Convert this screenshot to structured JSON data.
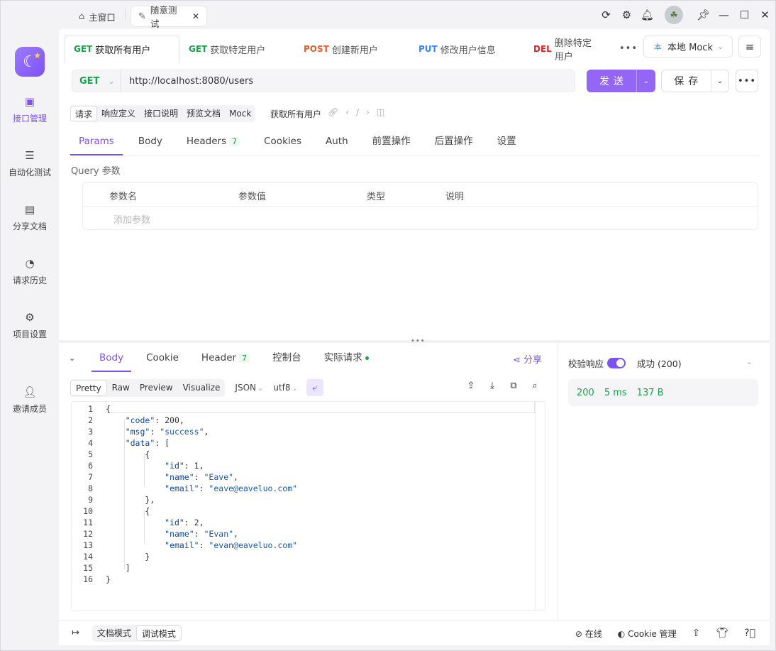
{
  "titlebar": {
    "home_tab": "主窗口",
    "active_tab": "随意测试"
  },
  "sidebar": {
    "items": [
      {
        "label": "接口管理",
        "icon": "api-management-icon"
      },
      {
        "label": "自动化测试",
        "icon": "automation-icon"
      },
      {
        "label": "分享文档",
        "icon": "share-doc-icon"
      },
      {
        "label": "请求历史",
        "icon": "history-icon"
      },
      {
        "label": "项目设置",
        "icon": "project-settings-icon"
      },
      {
        "label": "邀请成员",
        "icon": "invite-member-icon"
      }
    ]
  },
  "request_tabs": [
    {
      "method": "GET",
      "label": "获取所有用户"
    },
    {
      "method": "GET",
      "label": "获取特定用户"
    },
    {
      "method": "POST",
      "label": "创建新用户"
    },
    {
      "method": "PUT",
      "label": "修改用户信息"
    },
    {
      "method": "DEL",
      "label": "删除特定用户"
    }
  ],
  "environment": {
    "badge": "本",
    "label": "本地 Mock"
  },
  "url_bar": {
    "method": "GET",
    "url": "http://localhost:8080/users"
  },
  "actions": {
    "send": "发送",
    "save": "保存"
  },
  "view_modes": [
    "请求",
    "响应定义",
    "接口说明",
    "预览文档",
    "Mock"
  ],
  "view_title": "获取所有用户",
  "sub_tabs": {
    "params": "Params",
    "body": "Body",
    "headers": "Headers",
    "headers_count": "7",
    "cookies": "Cookies",
    "auth": "Auth",
    "pre": "前置操作",
    "post": "后置操作",
    "settings": "设置"
  },
  "query": {
    "label": "Query 参数",
    "columns": [
      "参数名",
      "参数值",
      "类型",
      "说明"
    ],
    "add_placeholder": "添加参数"
  },
  "response_tabs": {
    "body": "Body",
    "cookie": "Cookie",
    "header": "Header",
    "header_count": "7",
    "console": "控制台",
    "actual": "实际请求",
    "share": "分享"
  },
  "format": {
    "modes": [
      "Pretty",
      "Raw",
      "Preview",
      "Visualize"
    ],
    "type": "JSON",
    "encoding": "utf8"
  },
  "code_lines": [
    "{",
    "    \"code\": 200,",
    "    \"msg\": \"success\",",
    "    \"data\": [",
    "        {",
    "            \"id\": 1,",
    "            \"name\": \"Eave\",",
    "            \"email\": \"eave@eaveluo.com\"",
    "        },",
    "        {",
    "            \"id\": 2,",
    "            \"name\": \"Evan\",",
    "            \"email\": \"evan@eaveluo.com\"",
    "        }",
    "    ]",
    "}"
  ],
  "validation": {
    "label": "校验响应",
    "status": "成功 (200)"
  },
  "stats": {
    "status": "200",
    "time": "5 ms",
    "size": "137 B"
  },
  "bottom": {
    "doc_mode": "文档模式",
    "debug_mode": "调试模式",
    "online": "在线",
    "cookie_mgr": "Cookie 管理"
  },
  "colors": {
    "accent": "#7b52f0",
    "get": "#16a34a",
    "post": "#e25b2c",
    "put": "#3b82f6",
    "del": "#dc2626"
  }
}
